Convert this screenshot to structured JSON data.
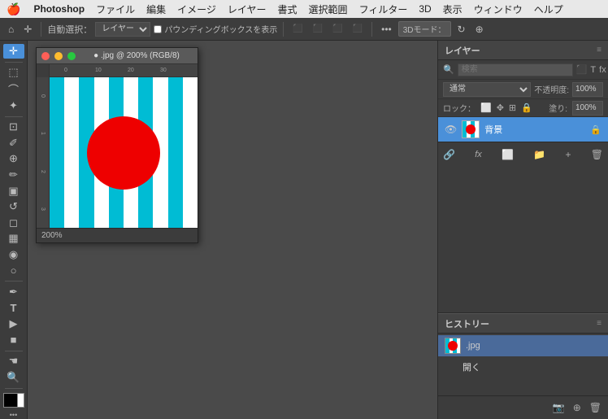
{
  "menubar": {
    "apple": "🍎",
    "items": [
      "Photoshop",
      "ファイル",
      "編集",
      "イメージ",
      "レイヤー",
      "書式",
      "選択範囲",
      "フィルター",
      "3D",
      "表示",
      "ウィンドウ",
      "ヘルプ"
    ]
  },
  "toolbar": {
    "auto_select_label": "自動選択：",
    "layer_select": "レイヤー",
    "bounding_box_label": "パウンディングボックスを表示",
    "mode_3d": "3Dモード："
  },
  "document": {
    "title": "● .jpg @ 200% (RGB/8)",
    "zoom_label": "200%"
  },
  "layers_panel": {
    "title": "レイヤー",
    "search_placeholder": "検索",
    "mode_label": "通常",
    "opacity_label": "不透明度:",
    "opacity_value": "100%",
    "fill_label": "塗り:",
    "fill_value": "100%",
    "lock_label": "ロック：",
    "layer_name": "背景",
    "bottom_icons": [
      "link-icon",
      "fx-icon",
      "mask-icon",
      "folder-icon",
      "adjustment-icon",
      "delete-icon"
    ]
  },
  "history_panel": {
    "title": "ヒストリー",
    "items": [
      {
        "name": ".jpg",
        "active": true
      },
      {
        "name": "開く",
        "active": false
      }
    ],
    "bottom_icons": [
      "snapshot-icon",
      "new-state-icon",
      "delete-icon"
    ]
  },
  "colors": {
    "cyan": "#00bcd4",
    "red": "#dd0000",
    "accent_blue": "#4a90d9"
  },
  "ruler": {
    "ticks": [
      0,
      10,
      20,
      30
    ]
  }
}
